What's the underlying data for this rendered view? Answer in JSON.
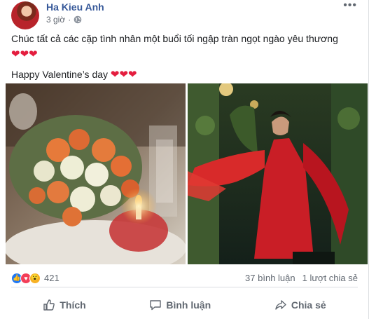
{
  "post": {
    "author": "Ha Kieu Anh",
    "time": "3 giờ",
    "more_label": "•••",
    "line1": "Chúc tất cả các cặp tình nhân một buổi tối ngập tràn ngọt ngào yêu thương",
    "hearts": "❤❤❤",
    "line2": "Happy Valentine’s day",
    "hearts2": "❤❤❤"
  },
  "stats": {
    "reaction_count": "421",
    "comments": "37 bình luận",
    "shares": "1 lượt chia sẻ"
  },
  "actions": {
    "like": "Thích",
    "comment": "Bình luận",
    "share": "Chia sẻ"
  },
  "colors": {
    "author_link": "#365899",
    "heart": "#e41e3f",
    "like_blue": "#2078f4",
    "love_red": "#f33e58"
  },
  "icons": [
    "globe-icon",
    "like-icon",
    "comment-icon",
    "share-icon",
    "more-icon"
  ]
}
